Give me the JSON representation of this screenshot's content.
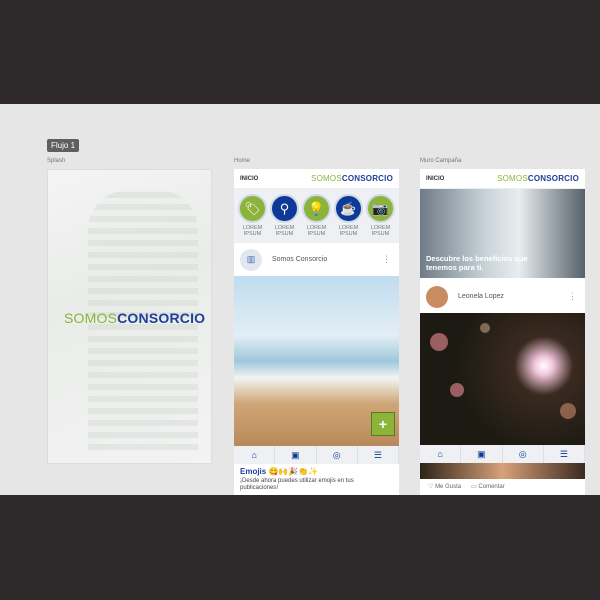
{
  "flow_label": "Flujo 1",
  "artboards": {
    "splash": {
      "label": "Splash",
      "logo": {
        "part1": "SOMOS",
        "part2": "CONSORCIO"
      }
    },
    "home": {
      "label": "Home",
      "header": {
        "title": "INICIO",
        "logo1": "SOMOS",
        "logo2": "CONSORCIO"
      },
      "icons": [
        {
          "icon": "tag-icon",
          "color": "#8cb33a",
          "label": "LOREM IPSUM"
        },
        {
          "icon": "location-pin-icon",
          "color": "#0d3a96",
          "label": "LOREM IPSUM"
        },
        {
          "icon": "lightbulb-icon",
          "color": "#8cb33a",
          "label": "LOREM IPSUM"
        },
        {
          "icon": "coffee-cup-icon",
          "color": "#0d3a96",
          "label": "LOREM IPSUM"
        },
        {
          "icon": "camera-icon",
          "color": "#8cb33a",
          "label": "LOREM IPSUM"
        }
      ],
      "post": {
        "author": "Somos Consorcio"
      },
      "fab": "+",
      "news": {
        "title": "Emojis 😋🙌🎉👏✨",
        "text": "¡Desde ahora puedes utilizar emojis en tus publicaciones!"
      }
    },
    "muro": {
      "label": "Muro Campaña",
      "header": {
        "title": "INICIO",
        "logo1": "SOMOS",
        "logo2": "CONSORCIO"
      },
      "hero_text": "Descubre los beneficios que tenemos para ti.",
      "post": {
        "author": "Leonela Lopez"
      },
      "actions": {
        "like": "Me Gusta",
        "comment": "Comentar"
      }
    }
  },
  "nav": [
    "home-icon",
    "contact-icon",
    "instagram-icon",
    "menu-icon"
  ],
  "colors": {
    "green": "#8cb33a",
    "blue": "#0d3a96"
  }
}
